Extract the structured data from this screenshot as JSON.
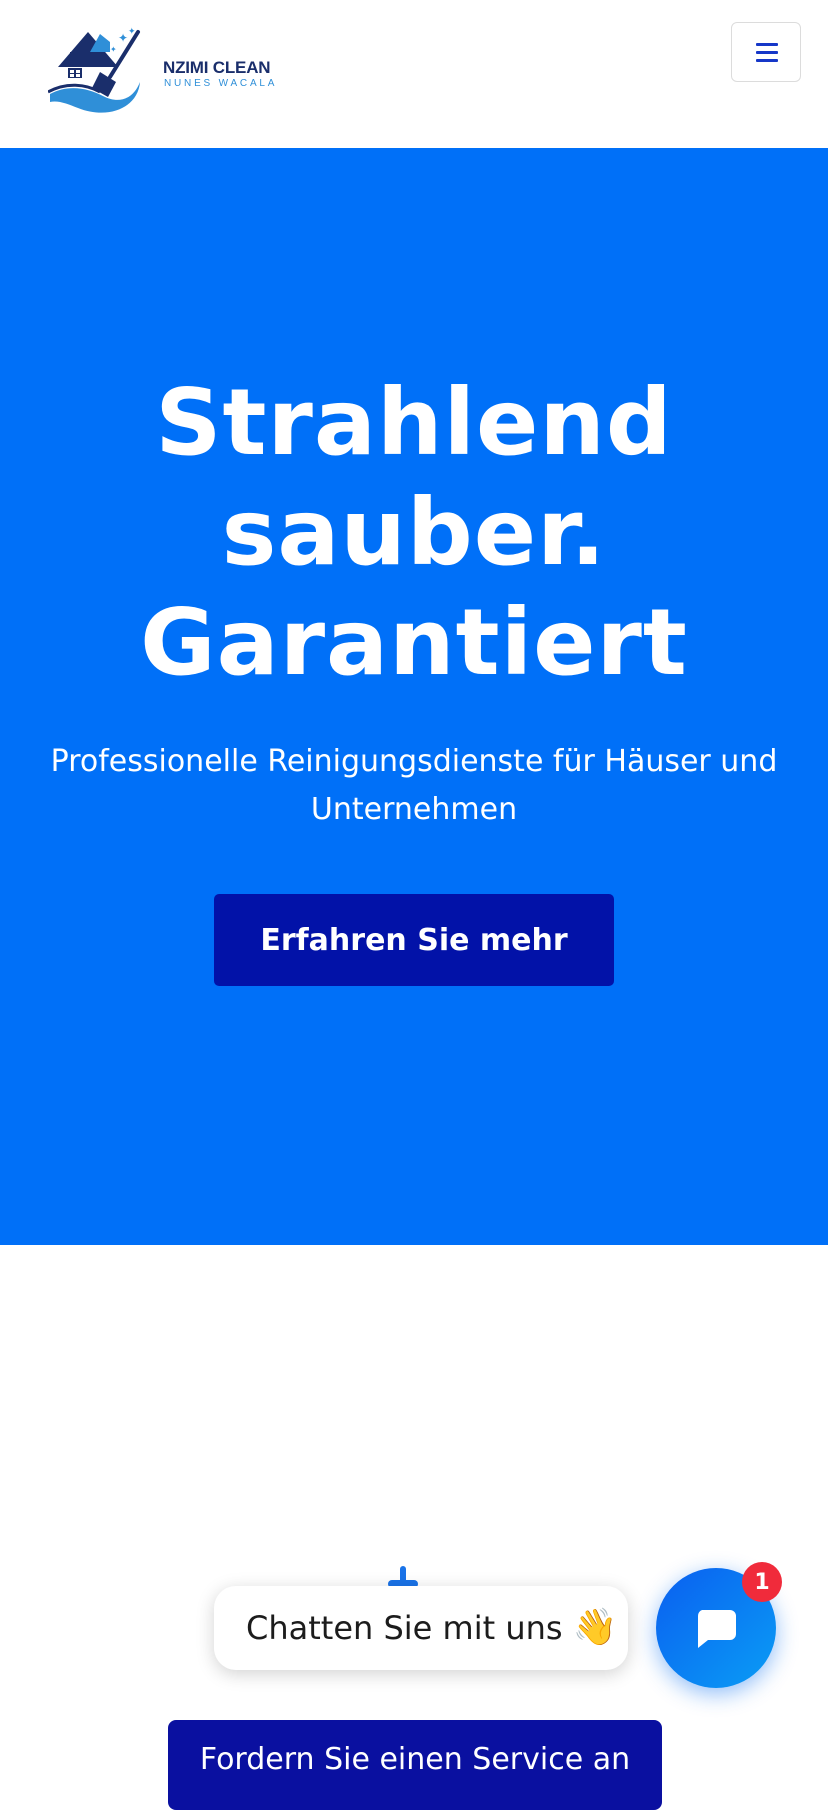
{
  "header": {
    "logo_title": "NZIMI CLEAN",
    "logo_subtitle": "NUNES WACALA",
    "menu_icon": "hamburger-icon"
  },
  "hero": {
    "title_lines": [
      "Strahlend",
      "sauber.",
      "Garantiert"
    ],
    "subtitle": "Professionelle Reinigungsdienste für Häuser und Unternehmen",
    "cta_label": "Erfahren Sie mehr"
  },
  "chat": {
    "bubble_label": "Chatten Sie mit uns",
    "bubble_emoji": "👋",
    "badge_count": "1",
    "launcher_icon": "chat-icon"
  },
  "service_button_label": "Fordern Sie einen Service an",
  "colors": {
    "hero_bg": "#0070f8",
    "cta_bg": "#0212a8",
    "service_bg": "#0a10a0",
    "badge": "#f02b3b",
    "brand_navy": "#1a2e6b"
  }
}
